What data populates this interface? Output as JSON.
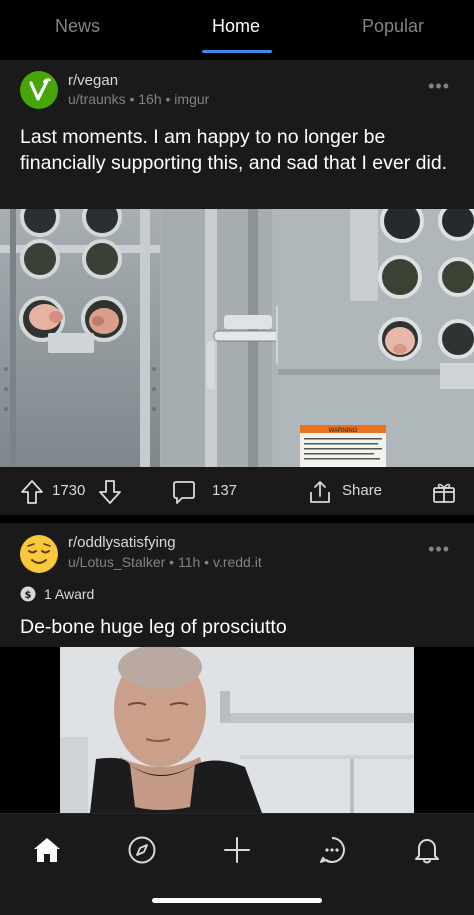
{
  "nav": {
    "tabs": [
      {
        "label": "News",
        "active": false
      },
      {
        "label": "Home",
        "active": true
      },
      {
        "label": "Popular",
        "active": false
      }
    ],
    "accent": "#3d8dea"
  },
  "posts": [
    {
      "subreddit": "r/vegan",
      "meta": "u/traunks • 16h • imgur",
      "title": "Last moments. I am happy to no longer be financially supporting this, and sad that I ever did.",
      "media_icon": "pig-truck-photo",
      "media_label": "WARNING",
      "votes": "1730",
      "comments": "137",
      "share_label": "Share",
      "avatar_color": "#46a508"
    },
    {
      "subreddit": "r/oddlysatisfying",
      "meta": "u/Lotus_Stalker • 11h • v.redd.it",
      "award": "1 Award",
      "title": "De-bone huge leg of prosciutto",
      "media_icon": "video-thumbnail"
    }
  ],
  "bottom_nav": {
    "items": [
      "home-icon",
      "discover-icon",
      "create-icon",
      "chat-icon",
      "notifications-icon"
    ]
  }
}
